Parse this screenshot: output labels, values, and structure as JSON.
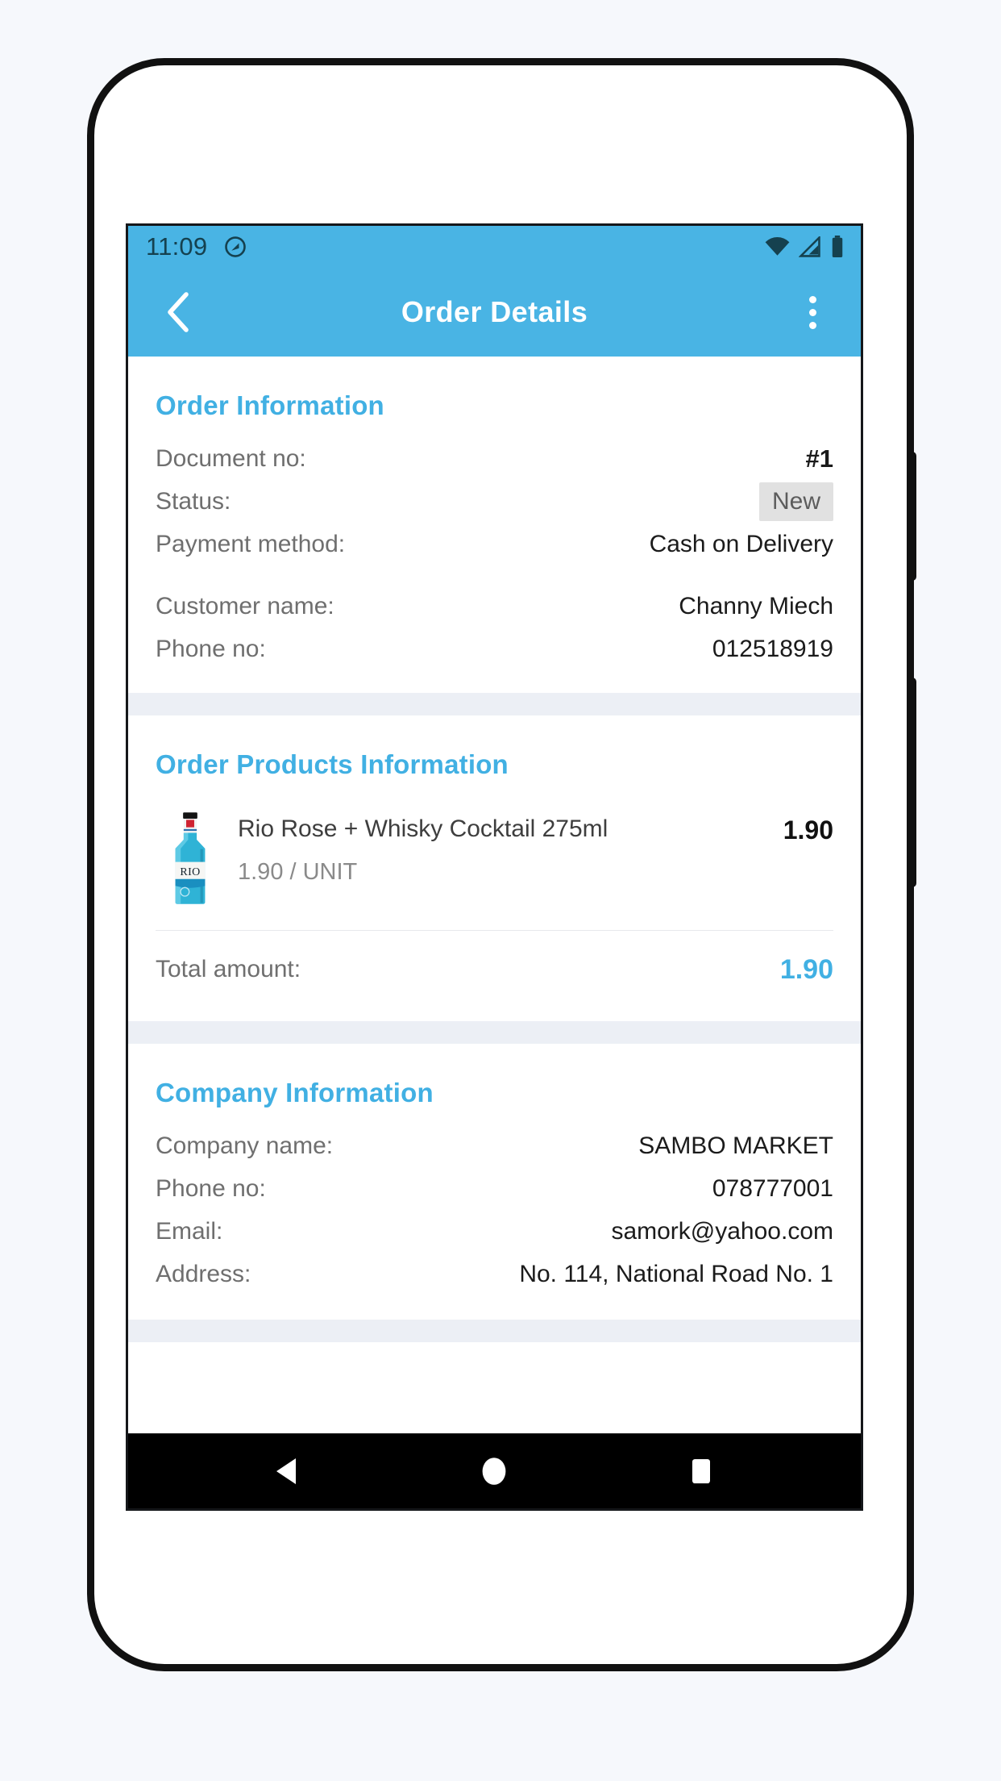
{
  "theme": {
    "accent": "#41b0e3",
    "app_bar": "#49b4e4",
    "band": "#eceff5",
    "badge_bg": "#e1e1e1"
  },
  "status_bar": {
    "time": "11:09",
    "left_icon": "assistant-circle-icon",
    "icons": [
      "wifi-icon",
      "signal-icon",
      "battery-icon"
    ]
  },
  "app_bar": {
    "back_icon": "back-chevron-icon",
    "title": "Order Details",
    "overflow_icon": "overflow-menu-icon"
  },
  "order_information": {
    "heading": "Order Information",
    "rows": [
      {
        "label": "Document no:",
        "value": "#1"
      },
      {
        "label": "Status:",
        "value": "New"
      },
      {
        "label": "Payment method:",
        "value": "Cash on Delivery"
      },
      {
        "label": "Customer name:",
        "value": "Channy Miech"
      },
      {
        "label": "Phone no:",
        "value": "012518919"
      }
    ]
  },
  "order_products_information": {
    "heading": "Order Products Information",
    "product": {
      "image_alt": "rio-rose-whisky-cocktail-bottle",
      "name": "Rio Rose + Whisky Cocktail 275ml",
      "unit_price": "1.90 / UNIT",
      "line_total": "1.90"
    },
    "total_label": "Total amount:",
    "total_value": "1.90"
  },
  "company_information": {
    "heading": "Company Information",
    "rows": [
      {
        "label": "Company name:",
        "value": "SAMBO MARKET"
      },
      {
        "label": "Phone no:",
        "value": "078777001"
      },
      {
        "label": "Email:",
        "value": "samork@yahoo.com"
      },
      {
        "label": "Address:",
        "value": "No. 114, National Road No. 1"
      }
    ]
  },
  "nav_bar": {
    "back": "nav-back-icon",
    "home": "nav-home-icon",
    "recents": "nav-recents-icon"
  }
}
